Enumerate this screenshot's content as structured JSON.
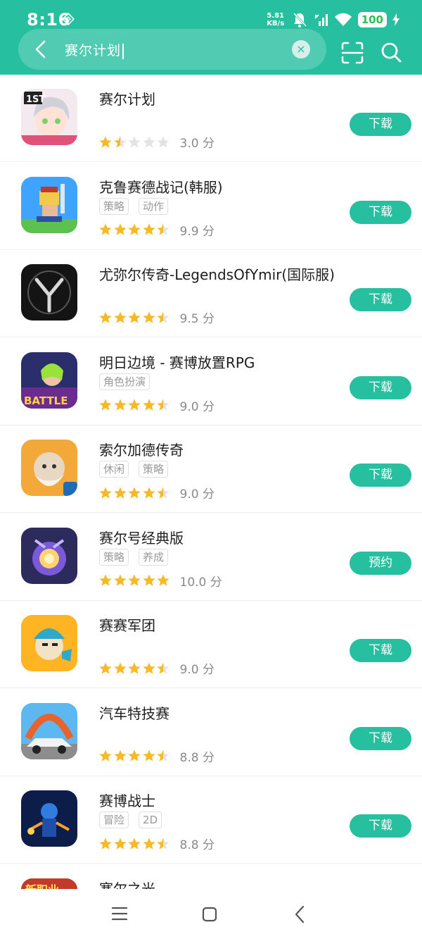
{
  "status_bar": {
    "time": "8:16",
    "net_speed_value": "5.81",
    "net_speed_unit": "KB/s",
    "battery": "100"
  },
  "search": {
    "query": "赛尔计划",
    "clear_symbol": "×"
  },
  "apps": [
    {
      "name": "赛尔计划",
      "tags": [],
      "rating": 3.0,
      "score_text": "3.0 分",
      "button": "下载",
      "icon": "anime-girl-1st-icon"
    },
    {
      "name": "克鲁赛德战记(韩服)",
      "tags": [
        "策略",
        "动作"
      ],
      "rating": 9.9,
      "score_text": "9.9 分",
      "button": "下载",
      "icon": "pixel-knight-icon"
    },
    {
      "name": "尤弥尔传奇-LegendsOfYmir(国际服)",
      "tags": [],
      "rating": 9.5,
      "score_text": "9.5 分",
      "button": "下载",
      "icon": "ymir-y-logo-icon"
    },
    {
      "name": "明日边境 - 赛博放置RPG",
      "tags": [
        "角色扮演"
      ],
      "rating": 9.0,
      "score_text": "9.0 分",
      "button": "下载",
      "icon": "battle-night-girl-icon"
    },
    {
      "name": "索尔加德传奇",
      "tags": [
        "休闲",
        "策略"
      ],
      "rating": 9.0,
      "score_text": "9.0 分",
      "button": "下载",
      "icon": "viking-elder-icon"
    },
    {
      "name": "赛尔号经典版",
      "tags": [
        "策略",
        "养成"
      ],
      "rating": 10.0,
      "score_text": "10.0 分",
      "button": "预约",
      "icon": "seer-robot-icon"
    },
    {
      "name": "赛赛军团",
      "tags": [],
      "rating": 9.0,
      "score_text": "9.0 分",
      "button": "下载",
      "icon": "cartoon-soldier-icon"
    },
    {
      "name": "汽车特技赛",
      "tags": [],
      "rating": 8.8,
      "score_text": "8.8 分",
      "button": "下载",
      "icon": "stunt-car-icon"
    },
    {
      "name": "赛博战士",
      "tags": [
        "冒险",
        "2D"
      ],
      "rating": 8.8,
      "score_text": "8.8 分",
      "button": "下载",
      "icon": "cyber-warrior-icon"
    },
    {
      "name": "塞尔之光",
      "tags": [],
      "rating": null,
      "score_text": "",
      "button": "",
      "icon": "new-career-icon"
    }
  ],
  "colors": {
    "accent": "#26bf9f",
    "star_filled": "#f7b924",
    "star_empty": "#e3e3e3"
  }
}
